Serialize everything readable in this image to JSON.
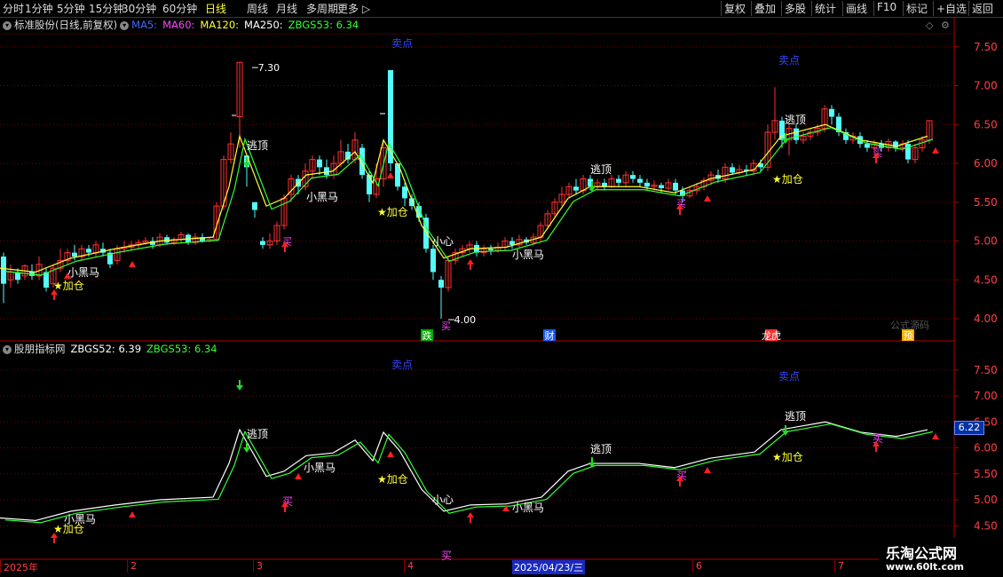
{
  "toolbar": {
    "left_items": [
      "分时",
      "1分钟",
      "5分钟",
      "15分钟",
      "30分钟",
      "60分钟",
      "日线",
      "周线",
      "月线",
      "多周期",
      "更多 ▷"
    ],
    "active": "日线",
    "right_items": [
      "复权",
      "叠加",
      "多股",
      "统计",
      "画线",
      "F10",
      "标记",
      "+自选",
      "返回"
    ]
  },
  "pane1": {
    "title": "标准股份(日线,前复权)",
    "ma5": "MA5:",
    "ma60": "MA60:",
    "ma120": "MA120:",
    "ma250": "MA250:",
    "zbgs53": "ZBGS53: 6.34",
    "colors": {
      "ma5": "#4466ff",
      "ma60": "#ff44ff",
      "ma120": "#ffff33",
      "ma250": "#ffffff",
      "zbgs53": "#33ff33"
    }
  },
  "pane2": {
    "title": "股朋指标网",
    "zbgs52": "ZBGS52: 6.39",
    "zbgs53": "ZBGS53: 6.34",
    "colors": {
      "zbgs52": "#ffffff",
      "zbgs53": "#33ff33"
    }
  },
  "axis1_ticks": [
    "7.50",
    "7.00",
    "6.50",
    "6.00",
    "5.50",
    "5.00",
    "4.50",
    "4.00"
  ],
  "axis2_ticks": [
    "7.50",
    "7.00",
    "6.50",
    "6.00",
    "5.50",
    "5.00",
    "4.50"
  ],
  "axis2_current": "6.22",
  "price_labels": {
    "high": "7.30",
    "low": "4.00"
  },
  "signals": {
    "escape_top": "逃顶",
    "dark_horse": "小黑马",
    "add_position": "★加仓",
    "buy": "买",
    "sell_point": "卖点",
    "caution": "小心"
  },
  "bottom_markers": [
    "跌",
    "财",
    "龙虎",
    "预"
  ],
  "dates": {
    "year": "2025年",
    "months": [
      "2",
      "3",
      "4",
      "6",
      "7"
    ],
    "current": "2025/04/23/三"
  },
  "watermark": "公式源码",
  "badge": {
    "title": "乐淘公式网",
    "url": "www.60lt.com"
  }
}
